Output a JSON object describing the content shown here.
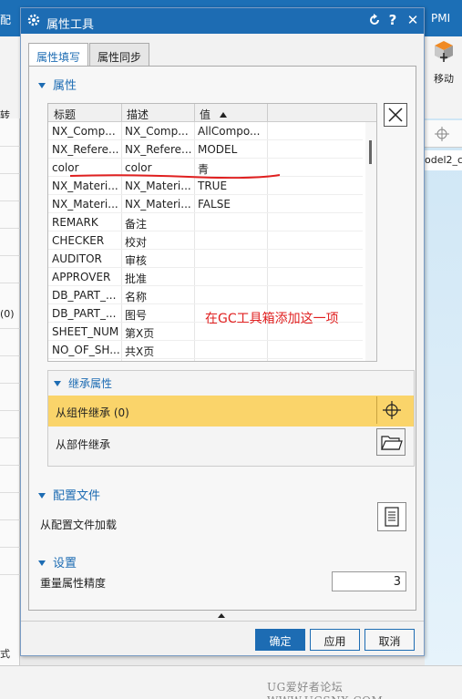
{
  "background": {
    "topbar_left_label": "配",
    "topbar_right_label": "PMI",
    "rotate_label": "转",
    "move_label": "移动",
    "left_value": "(0)",
    "model_tab": "odel2_c",
    "bottom_left_text": "式",
    "watermark": "UG爱好者论坛 WWW.UGSNX.COM"
  },
  "dialog": {
    "title": "属性工具",
    "tabs": [
      "属性填写",
      "属性同步"
    ],
    "attributes_section": "属性",
    "table": {
      "headers": [
        "标题",
        "描述",
        "值"
      ],
      "rows": [
        [
          "NX_Comp...",
          "NX_Comp...",
          "AllCompo..."
        ],
        [
          "NX_Refere...",
          "NX_Refere...",
          "MODEL"
        ],
        [
          "color",
          "color",
          "青"
        ],
        [
          "NX_Materi...",
          "NX_Materi...",
          "TRUE"
        ],
        [
          "NX_Materi...",
          "NX_Materi...",
          "FALSE"
        ],
        [
          "REMARK",
          "备注",
          ""
        ],
        [
          "CHECKER",
          "校对",
          ""
        ],
        [
          "AUDITOR",
          "审核",
          ""
        ],
        [
          "APPROVER",
          "批准",
          ""
        ],
        [
          "DB_PART_...",
          "名称",
          ""
        ],
        [
          "DB_PART_...",
          "图号",
          ""
        ],
        [
          "SHEET_NUM",
          "第X页",
          ""
        ],
        [
          "NO_OF_SH...",
          "共X页",
          ""
        ]
      ]
    },
    "annotation": "在GC工具箱添加这一项",
    "inherit": {
      "title": "继承属性",
      "from_component": "从组件继承 (0)",
      "from_part": "从部件继承"
    },
    "config": {
      "title": "配置文件",
      "load_label": "从配置文件加载"
    },
    "settings": {
      "title": "设置",
      "mass_precision_label": "重量属性精度",
      "mass_precision_value": "3"
    },
    "buttons": {
      "ok": "确定",
      "apply": "应用",
      "cancel": "取消"
    }
  },
  "colors": {
    "title_blue": "#1d6cb3",
    "selected_row": "#fad46a",
    "annotation_red": "#e02020"
  }
}
